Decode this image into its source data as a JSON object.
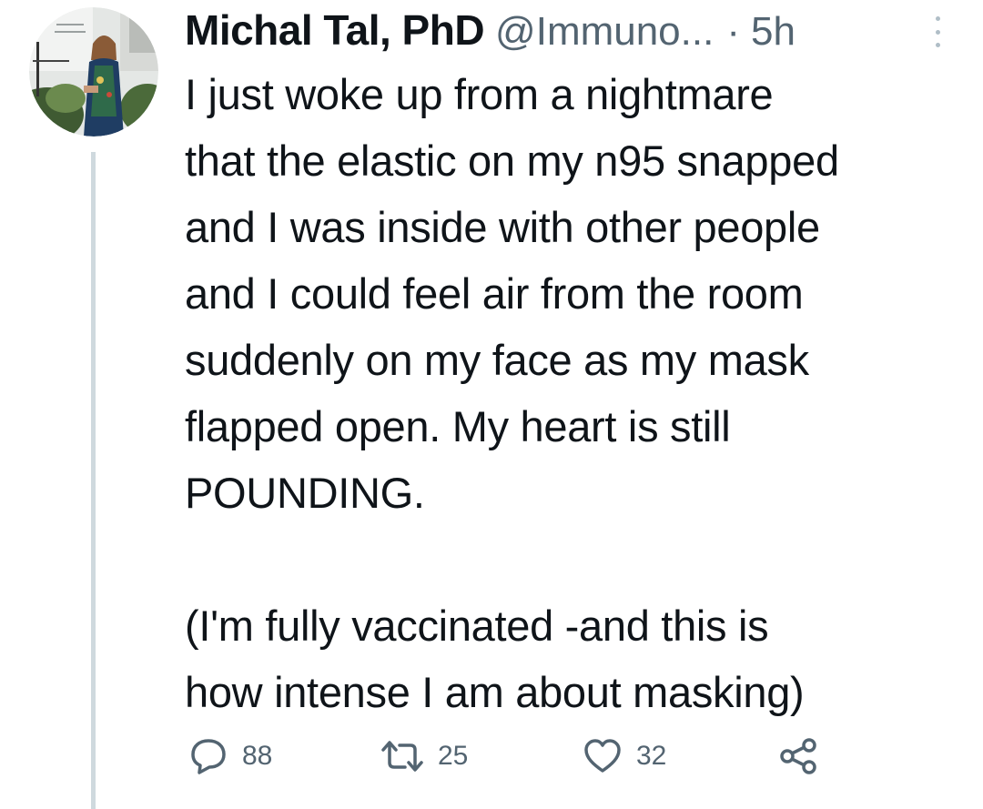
{
  "tweet": {
    "author": {
      "name": "Michal Tal, PhD",
      "handle": "@Immuno...",
      "avatar_icon": "profile-photo"
    },
    "separator": "·",
    "time": "5h",
    "text": {
      "paragraph1_lines": [
        "I just woke up from a nightmare",
        "that the elastic on my n95 snapped",
        "and I was inside with other people",
        "and I could feel air from the room",
        "suddenly on my face as my mask",
        "flapped open. My heart is still",
        "POUNDING."
      ],
      "paragraph2_lines": [
        "(I'm fully vaccinated -and this is",
        "how intense I am about masking)"
      ]
    },
    "actions": {
      "reply": {
        "icon": "reply-icon",
        "count": "88"
      },
      "retweet": {
        "icon": "retweet-icon",
        "count": "25"
      },
      "like": {
        "icon": "heart-icon",
        "count": "32"
      },
      "share": {
        "icon": "share-icon"
      }
    },
    "colors": {
      "text": "#0f1419",
      "secondary": "#536471",
      "thread_line": "#cfd9de"
    }
  }
}
